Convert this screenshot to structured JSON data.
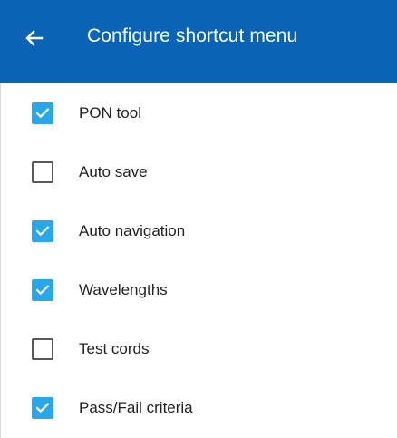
{
  "appbar": {
    "title": "Configure shortcut menu",
    "back_icon": "back-arrow-icon",
    "background_color": "#0b63b6"
  },
  "items": [
    {
      "label": "PON tool",
      "checked": true
    },
    {
      "label": "Auto save",
      "checked": false
    },
    {
      "label": "Auto navigation",
      "checked": true
    },
    {
      "label": "Wavelengths",
      "checked": true
    },
    {
      "label": "Test cords",
      "checked": false
    },
    {
      "label": "Pass/Fail criteria",
      "checked": true
    }
  ],
  "colors": {
    "checkbox_checked": "#2aa7ea",
    "checkbox_unchecked_border": "#595959"
  }
}
